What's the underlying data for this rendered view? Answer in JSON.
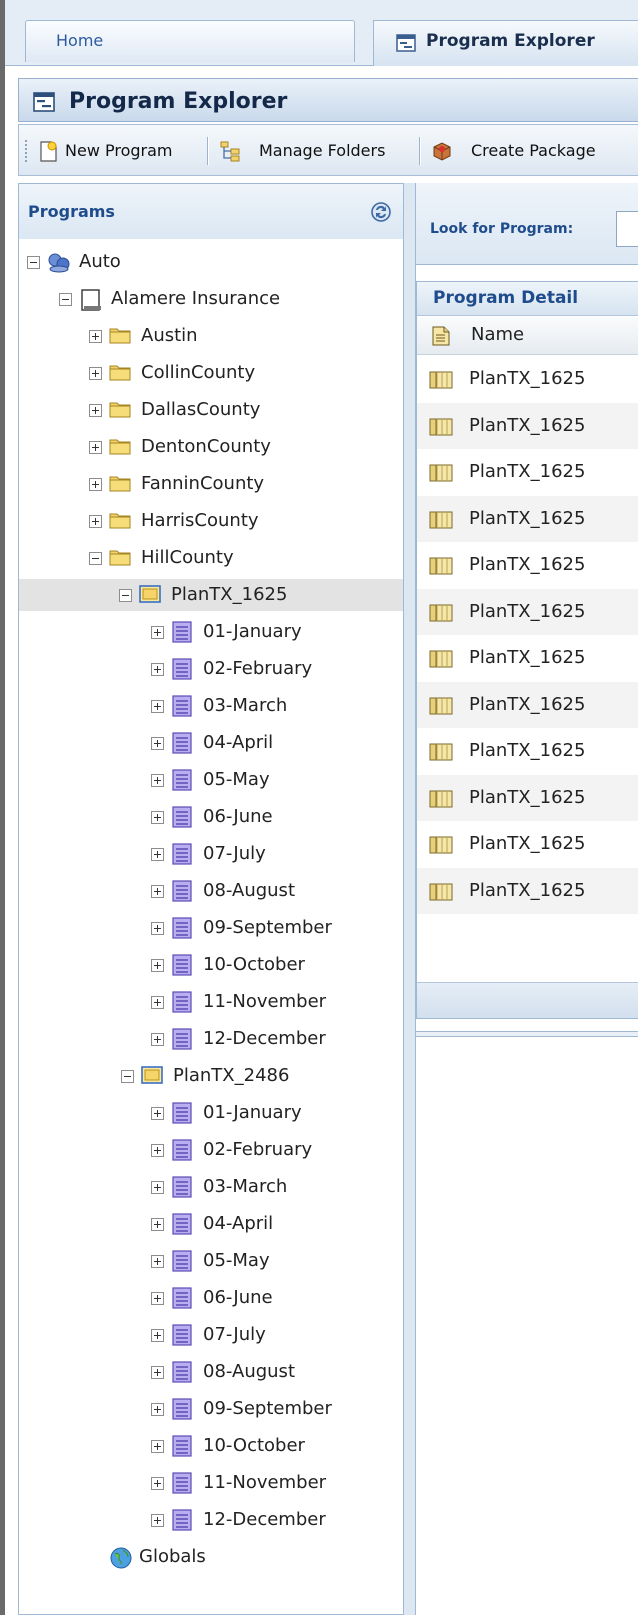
{
  "tabs": {
    "home": "Home",
    "program_explorer": "Program Explorer"
  },
  "title": "Program Explorer",
  "toolbar": {
    "new_program": "New Program",
    "manage_folders": "Manage Folders",
    "create_package": "Create Package"
  },
  "left_panel": {
    "title": "Programs"
  },
  "tree": {
    "auto": "Auto",
    "alamere": "Alamere Insurance",
    "counties": [
      "Austin",
      "CollinCounty",
      "DallasCounty",
      "DentonCounty",
      "FanninCounty",
      "HarrisCounty",
      "HillCounty"
    ],
    "plan1": "PlanTX_1625",
    "plan2": "PlanTX_2486",
    "months": [
      "01-January",
      "02-February",
      "03-March",
      "04-April",
      "05-May",
      "06-June",
      "07-July",
      "08-August",
      "09-September",
      "10-October",
      "11-November",
      "12-December"
    ],
    "globals": "Globals"
  },
  "right_panel": {
    "look_for_label": "Look for Program:",
    "detail_title": "Program Detail",
    "name_col": "Name",
    "rows": [
      "PlanTX_1625",
      "PlanTX_1625",
      "PlanTX_1625",
      "PlanTX_1625",
      "PlanTX_1625",
      "PlanTX_1625",
      "PlanTX_1625",
      "PlanTX_1625",
      "PlanTX_1625",
      "PlanTX_1625",
      "PlanTX_1625",
      "PlanTX_1625"
    ]
  },
  "colors": {
    "accent": "#1f4c8c",
    "panel_border": "#9fb8d4",
    "folder_yellow": "#f2d36b",
    "month_purple": "#8e7fd1"
  }
}
